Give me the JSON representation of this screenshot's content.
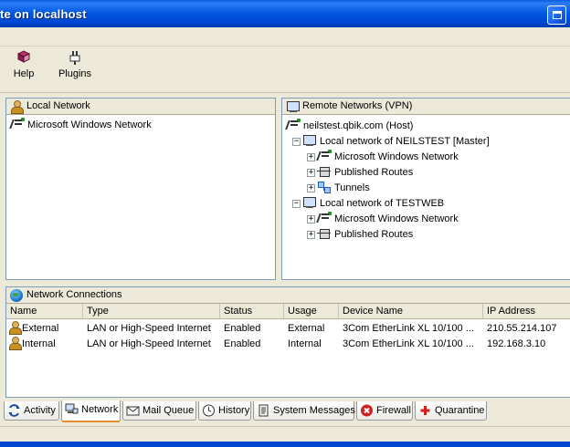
{
  "window": {
    "title": "te on localhost"
  },
  "toolbar": {
    "buttons": [
      {
        "label": "Help",
        "icon": "help-book-icon"
      },
      {
        "label": "Plugins",
        "icon": "plugins-icon"
      }
    ]
  },
  "local_panel": {
    "header": "Local Network",
    "items": [
      {
        "label": "Microsoft Windows Network",
        "icon": "network-icon"
      }
    ]
  },
  "remote_panel": {
    "header": "Remote Networks (VPN)",
    "tree": [
      {
        "label": "neilstest.qbik.com (Host)",
        "icon": "network-icon",
        "depth": 0,
        "expander": ""
      },
      {
        "label": "Local network of NEILSTEST [Master]",
        "icon": "computer-icon",
        "depth": 1,
        "expander": "−"
      },
      {
        "label": "Microsoft Windows Network",
        "icon": "network-icon",
        "depth": 2,
        "expander": "+"
      },
      {
        "label": "Published Routes",
        "icon": "route-icon",
        "depth": 2,
        "expander": "+"
      },
      {
        "label": "Tunnels",
        "icon": "tunnel-icon",
        "depth": 2,
        "expander": "+"
      },
      {
        "label": "Local network of TESTWEB",
        "icon": "computer-icon",
        "depth": 1,
        "expander": "−"
      },
      {
        "label": "Microsoft Windows Network",
        "icon": "network-icon",
        "depth": 2,
        "expander": "+"
      },
      {
        "label": "Published Routes",
        "icon": "route-icon",
        "depth": 2,
        "expander": "+"
      }
    ]
  },
  "connections_panel": {
    "header": "Network Connections",
    "columns": [
      "Name",
      "Type",
      "Status",
      "Usage",
      "Device Name",
      "IP Address"
    ],
    "rows": [
      [
        "External",
        "LAN or High-Speed Internet",
        "Enabled",
        "External",
        "3Com EtherLink XL 10/100 ...",
        "210.55.214.107"
      ],
      [
        "Internal",
        "LAN or High-Speed Internet",
        "Enabled",
        "Internal",
        "3Com EtherLink XL 10/100 ...",
        "192.168.3.10"
      ]
    ]
  },
  "tabs": [
    {
      "label": "Activity",
      "icon": "activity-icon",
      "active": false
    },
    {
      "label": "Network",
      "icon": "network-tab-icon",
      "active": true
    },
    {
      "label": "Mail Queue",
      "icon": "mail-icon",
      "active": false
    },
    {
      "label": "History",
      "icon": "clock-icon",
      "active": false
    },
    {
      "label": "System Messages",
      "icon": "document-icon",
      "active": false
    },
    {
      "label": "Firewall",
      "icon": "firewall-icon",
      "active": false
    },
    {
      "label": "Quarantine",
      "icon": "quarantine-icon",
      "active": false
    }
  ],
  "colors": {
    "title_bar": "#0056e0",
    "active_tab_accent": "#e68b2c",
    "firewall_red": "#d02020"
  }
}
